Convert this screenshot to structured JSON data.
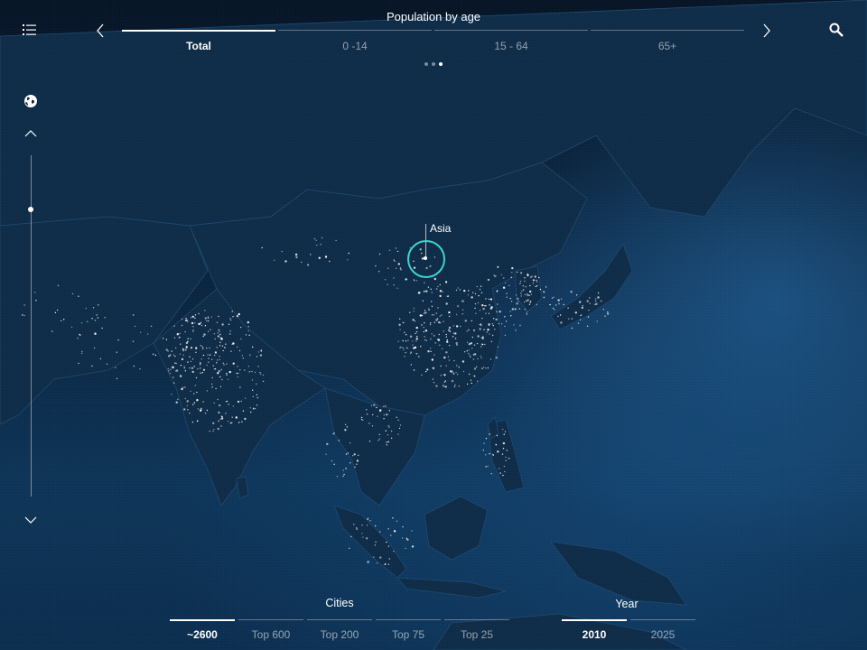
{
  "header": {
    "title": "Population by age",
    "tabs": [
      {
        "label": "Total",
        "active": true
      },
      {
        "label": "0 -14",
        "active": false
      },
      {
        "label": "15 - 64",
        "active": false
      },
      {
        "label": "65+",
        "active": false
      }
    ],
    "pager_count": 3,
    "pager_active": 2
  },
  "map": {
    "region_label": "Asia",
    "marker_color": "#3dd4d0"
  },
  "zoom": {
    "level": 0.16
  },
  "cities": {
    "title": "Cities",
    "options": [
      "~2600",
      "Top 600",
      "Top 200",
      "Top 75",
      "Top 25"
    ],
    "selected": 0
  },
  "year": {
    "title": "Year",
    "options": [
      "2010",
      "2025"
    ],
    "selected": 0
  },
  "icons": {
    "menu": "list-icon",
    "prev": "chevron-left-icon",
    "next": "chevron-right-icon",
    "search": "search-icon",
    "globe": "globe-icon",
    "zoom_in": "chevron-up-icon",
    "zoom_out": "chevron-down-icon"
  }
}
